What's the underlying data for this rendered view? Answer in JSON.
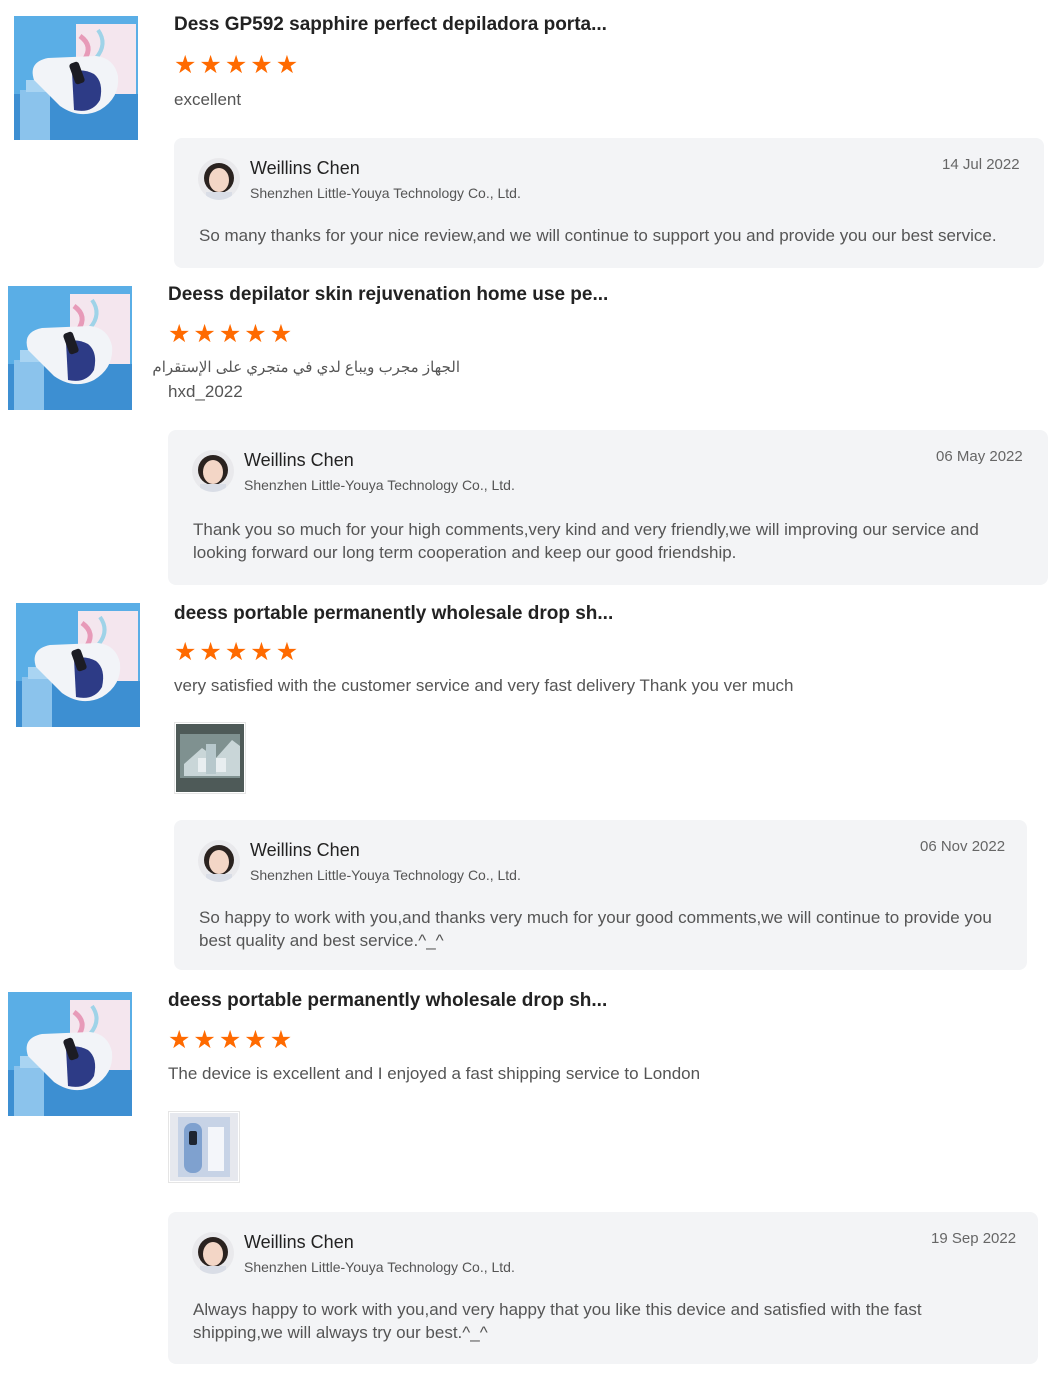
{
  "reviews": [
    {
      "title": "Dess GP592 sapphire perfect depiladora porta...",
      "rating": 5,
      "comment": "excellent",
      "reply": {
        "name": "Weillins Chen",
        "company": "Shenzhen Little-Youya Technology Co., Ltd.",
        "date": "14 Jul 2022",
        "text": "So many thanks for your nice review,and we will continue to support you and provide you our best service."
      }
    },
    {
      "title": "Deess depilator skin rejuvenation home use pe...",
      "rating": 5,
      "comment": "الجهاز مجرب ويباع لدي في متجري على الإستقرام",
      "author": "hxd_2022",
      "reply": {
        "name": "Weillins Chen",
        "company": "Shenzhen Little-Youya Technology Co., Ltd.",
        "date": "06 May 2022",
        "text_line1": "Thank you so much for your high comments,very kind and very friendly,we will improving our service and",
        "text_line2": "looking forward our long term cooperation and keep our good friendship."
      }
    },
    {
      "title": "deess portable permanently wholesale drop sh...",
      "rating": 5,
      "comment": "very satisfied with the customer service and very fast delivery Thank you ver much",
      "reply": {
        "name": "Weillins Chen",
        "company": "Shenzhen Little-Youya Technology Co., Ltd.",
        "date": "06 Nov 2022",
        "text_line1": "So happy to work with you,and thanks very much for your good comments,we will continue to provide you",
        "text_line2": "best quality and best service.^_^"
      }
    },
    {
      "title": "deess portable permanently wholesale drop sh...",
      "rating": 5,
      "comment": "The device is excellent and I enjoyed a fast shipping service to London",
      "reply": {
        "name": "Weillins Chen",
        "company": "Shenzhen Little-Youya Technology Co., Ltd.",
        "date": "19 Sep 2022",
        "text_line1": "Always happy to work with you,and very happy that you like this device and satisfied with the fast",
        "text_line2": "shipping,we will always try our best.^_^"
      }
    }
  ],
  "colors": {
    "star": "#ff6a00",
    "reply_bg": "#f3f4f6"
  },
  "icons": {
    "star": "star-icon"
  }
}
